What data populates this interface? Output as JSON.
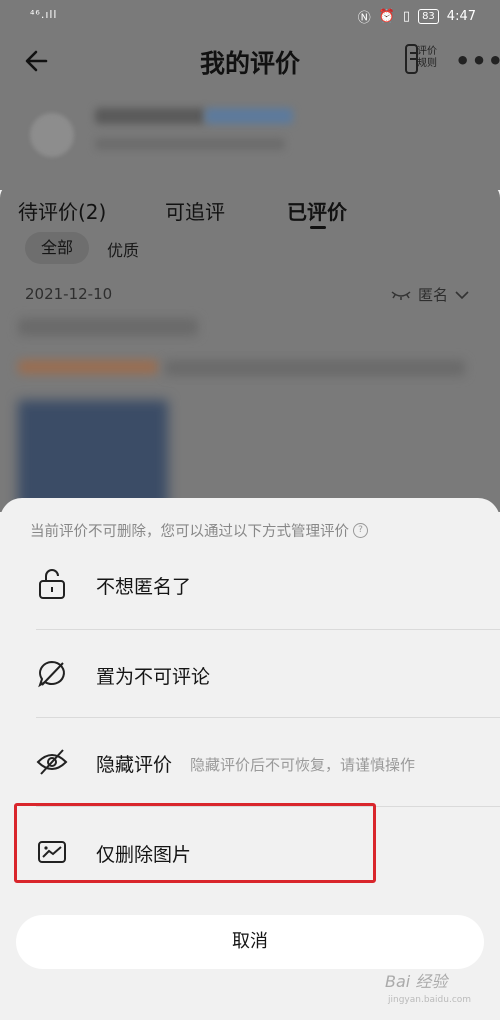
{
  "status_bar": {
    "signal": "⁴⁶.ıll",
    "battery": "83",
    "time": "4:47"
  },
  "header": {
    "title": "我的评价",
    "rules_label": "评价\n规则",
    "more": "•••"
  },
  "tabs": [
    {
      "label": "待评价(2)",
      "active": false
    },
    {
      "label": "可追评",
      "active": false
    },
    {
      "label": "已评价",
      "active": true
    }
  ],
  "filters": {
    "all": "全部",
    "quality": "优质"
  },
  "review": {
    "date": "2021-12-10",
    "anonymous_label": "匿名"
  },
  "sheet": {
    "note": "当前评价不可删除，您可以通过以下方式管理评价",
    "options": [
      {
        "label": "不想匿名了",
        "icon": "unlock-icon"
      },
      {
        "label": "置为不可评论",
        "icon": "no-comment-icon"
      },
      {
        "label": "隐藏评价",
        "hint": "隐藏评价后不可恢复，请谨慎操作",
        "icon": "hidden-eye-icon"
      },
      {
        "label": "仅删除图片",
        "icon": "image-icon"
      }
    ],
    "cancel": "取消"
  },
  "watermark": {
    "main": "Bai 经验",
    "sub": "jingyan.baidu.com"
  },
  "colors": {
    "highlight": "#d9262c",
    "overlay": "#7a7a7a"
  }
}
